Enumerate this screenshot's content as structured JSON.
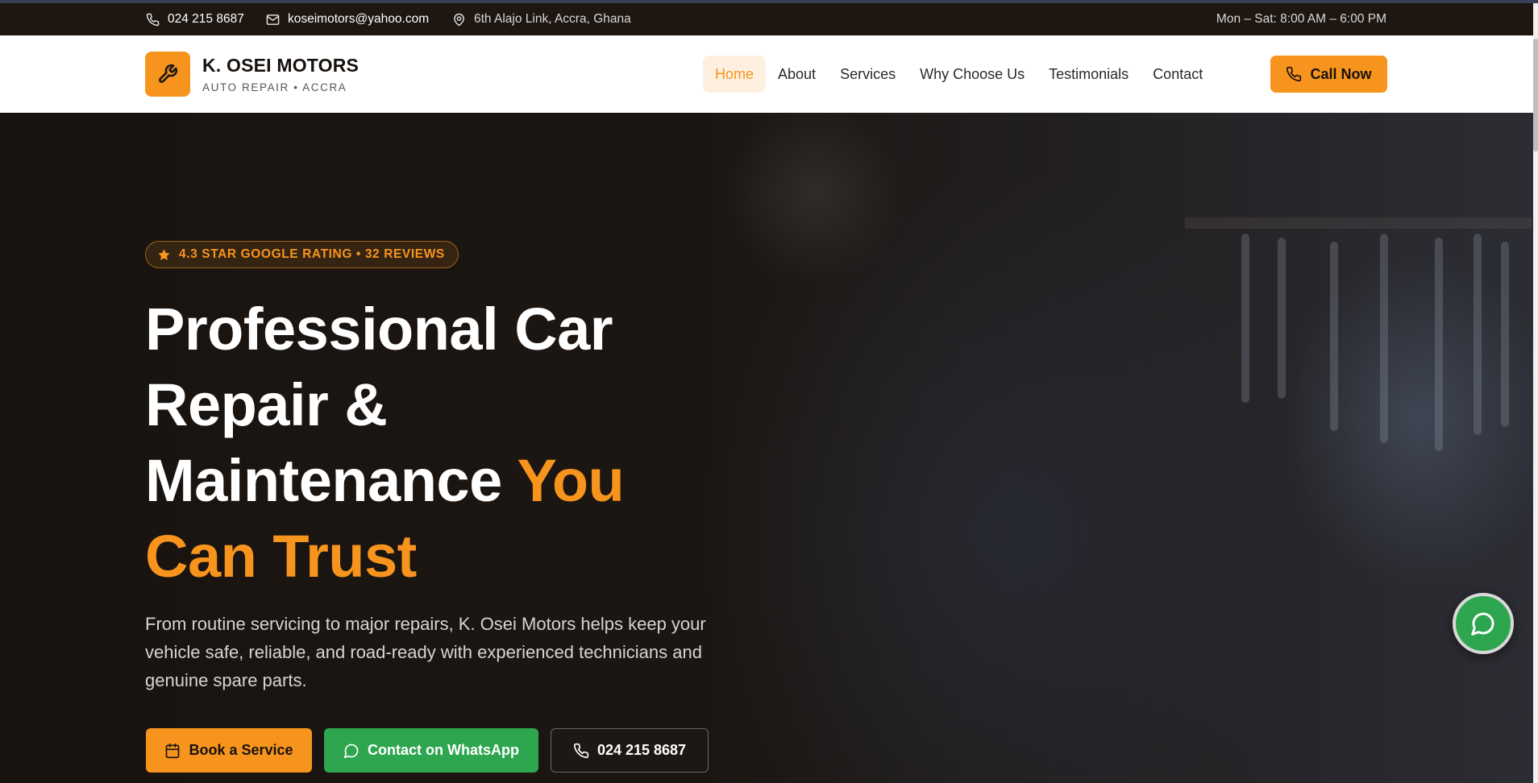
{
  "topbar": {
    "phone": "024 215 8687",
    "email": "koseimotors@yahoo.com",
    "address": "6th Alajo Link, Accra, Ghana",
    "hours": "Mon – Sat: 8:00 AM – 6:00 PM"
  },
  "header": {
    "brand_name": "K. OSEI MOTORS",
    "brand_sub": "AUTO REPAIR • ACCRA",
    "nav": [
      "Home",
      "About",
      "Services",
      "Why Choose Us",
      "Testimonials",
      "Contact"
    ],
    "active_nav": "Home",
    "cta_label": "Call Now"
  },
  "hero": {
    "badge": "4.3 STAR GOOGLE RATING • 32 REVIEWS",
    "headline_white": "Professional Car Repair & Maintenance",
    "headline_accent": "You Can Trust",
    "lead": "From routine servicing to major repairs, K. Osei Motors helps keep your vehicle safe, reliable, and road-ready with experienced technicians and genuine spare parts.",
    "buttons": {
      "book": "Book a Service",
      "whatsapp": "Contact on WhatsApp",
      "phone": "024 215 8687"
    }
  },
  "colors": {
    "accent": "#f7941d",
    "whatsapp_green": "#2ea54f",
    "topbar_bg": "#1d1611",
    "hero_bg": "#1a1512"
  },
  "icons": {
    "topbar": [
      "phone-icon",
      "mail-icon",
      "map-pin-icon"
    ],
    "logo": "wrench-icon",
    "badge": "star-icon",
    "book": "calendar-icon",
    "whatsapp": "chat-bubble-icon",
    "fab": "chat-bubble-icon"
  }
}
